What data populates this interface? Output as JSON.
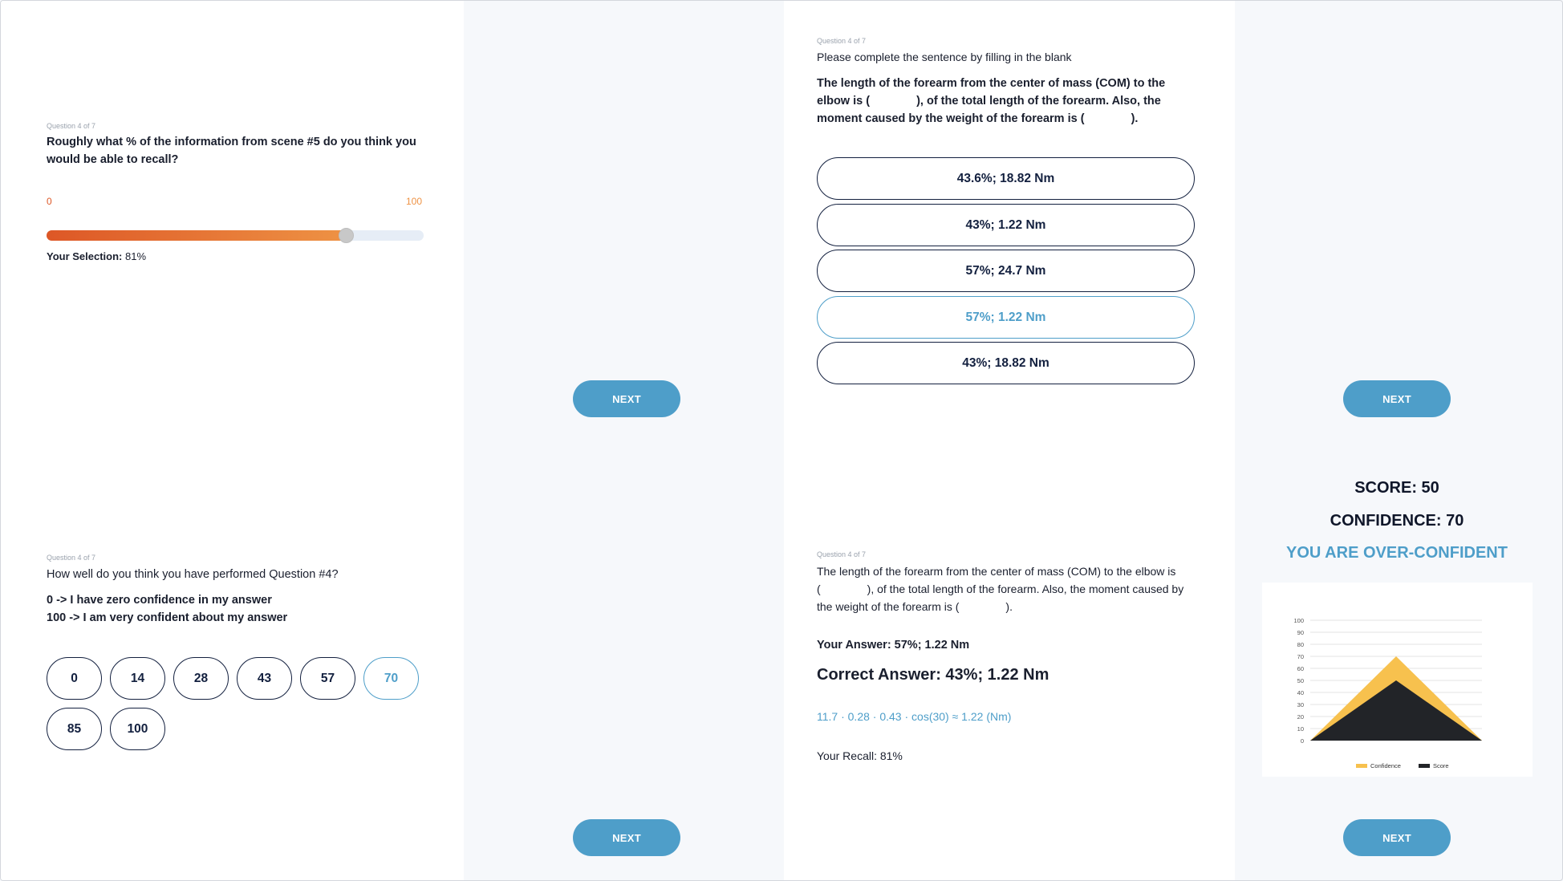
{
  "recall_screen": {
    "counter": "Question 4 of 7",
    "prompt_line1": "Roughly what % of the information from scene #5 do you think you",
    "prompt_line2": "would be able to recall?",
    "slider_min_label": "0",
    "slider_max_label": "100",
    "slider_value": 81,
    "selection_label": "Your Selection:",
    "selection_value": "81%"
  },
  "confidence_screen": {
    "counter": "Question 4 of 7",
    "prompt": "How well do you think you have performed Question #4?",
    "legend_line1": "0 -> I have zero confidence in my answer",
    "legend_line2": "100 -> I am very confident about my answer",
    "options": [
      "0",
      "14",
      "28",
      "43",
      "57",
      "70",
      "85",
      "100"
    ],
    "selected": "70"
  },
  "question_screen": {
    "counter": "Question 4 of 7",
    "instruction": "Please complete the sentence by filling in the blank",
    "sentence_line1": "The length of the forearm from the center of mass (COM) to the",
    "sentence_line2a": "elbow is (",
    "sentence_line2b": "), of the total length of the forearm. Also, the",
    "sentence_line3a": "moment caused by the weight of the forearm is (",
    "sentence_line3b": ").",
    "options": [
      "43.6%; 18.82 Nm",
      "43%; 1.22 Nm",
      "57%; 24.7 Nm",
      "57%; 1.22 Nm",
      "43%; 18.82 Nm"
    ],
    "selected": "57%; 1.22 Nm"
  },
  "feedback_screen": {
    "counter": "Question 4 of 7",
    "line1": "The length of the forearm from the center of mass (COM) to the elbow is",
    "line2a": "(",
    "line2b": "), of the total length of the forearm. Also, the moment caused by",
    "line3a": "the weight of the forearm is (",
    "line3b": ").",
    "your_answer": "Your Answer: 57%; 1.22 Nm",
    "correct_answer": "Correct Answer: 43%; 1.22 Nm",
    "formula": "11.7 · 0.28 · 0.43 · cos(30) ≈ 1.22 (Nm)",
    "recall": "Your Recall: 81%"
  },
  "result_screen": {
    "score_label": "SCORE: 50",
    "confidence_label": "CONFIDENCE: 70",
    "verdict": "YOU ARE OVER-CONFIDENT"
  },
  "buttons": {
    "next_label": "NEXT"
  },
  "colors": {
    "accent": "#4e9ec9",
    "navy": "#13203f",
    "orange_start": "#dd5726",
    "orange_end": "#ee9244",
    "confidence": "#f7c14e",
    "score": "#222428"
  },
  "chart_data": {
    "type": "area",
    "yticks": [
      "0",
      "10",
      "20",
      "30",
      "40",
      "50",
      "60",
      "70",
      "80",
      "90",
      "100"
    ],
    "ylim": [
      0,
      100
    ],
    "series": [
      {
        "name": "Confidence",
        "values": [
          0,
          70,
          0
        ],
        "color": "#f7c14e"
      },
      {
        "name": "Score",
        "values": [
          0,
          50,
          0
        ],
        "color": "#222428"
      }
    ],
    "legend_position": "bottom",
    "grid": true
  }
}
